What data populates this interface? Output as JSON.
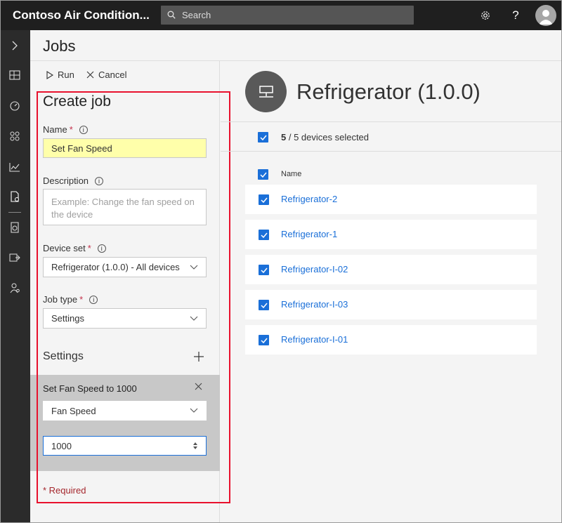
{
  "app": {
    "title": "Contoso Air Condition...",
    "search_placeholder": "Search"
  },
  "page": {
    "title": "Jobs"
  },
  "toolbar": {
    "run_label": "Run",
    "cancel_label": "Cancel"
  },
  "form": {
    "title": "Create job",
    "name_label": "Name",
    "name_value": "Set Fan Speed",
    "description_label": "Description",
    "description_placeholder": "Example: Change the fan speed on the device",
    "device_set_label": "Device set",
    "device_set_value": "Refrigerator (1.0.0) - All devices",
    "job_type_label": "Job type",
    "job_type_value": "Settings",
    "required_mark": "*",
    "settings_label": "Settings",
    "setting": {
      "title": "Set Fan Speed to 1000",
      "property": "Fan Speed",
      "value": "1000"
    },
    "required_note": "* Required"
  },
  "devices": {
    "title": "Refrigerator (1.0.0)",
    "selected_count": "5",
    "selected_suffix": " / 5 devices selected",
    "column_name": "Name",
    "rows": [
      {
        "name": "Refrigerator-2"
      },
      {
        "name": "Refrigerator-1"
      },
      {
        "name": "Refrigerator-I-02"
      },
      {
        "name": "Refrigerator-I-03"
      },
      {
        "name": "Refrigerator-I-01"
      }
    ]
  },
  "colors": {
    "accent": "#1a6fd8",
    "topbar": "#1f1f1f",
    "leftnav": "#2b2b2b",
    "highlight": "#e8112d",
    "name_field_bg": "#ffffaa"
  },
  "icons": {
    "nav": [
      "expand-chevron-icon",
      "dashboard-icon",
      "device-explorer-icon",
      "app-templates-icon",
      "analytics-icon",
      "jobs-icon",
      "device-templates-icon",
      "data-export-icon",
      "administration-icon"
    ],
    "topbar": [
      "settings-gear-icon",
      "help-icon",
      "avatar-icon"
    ]
  }
}
